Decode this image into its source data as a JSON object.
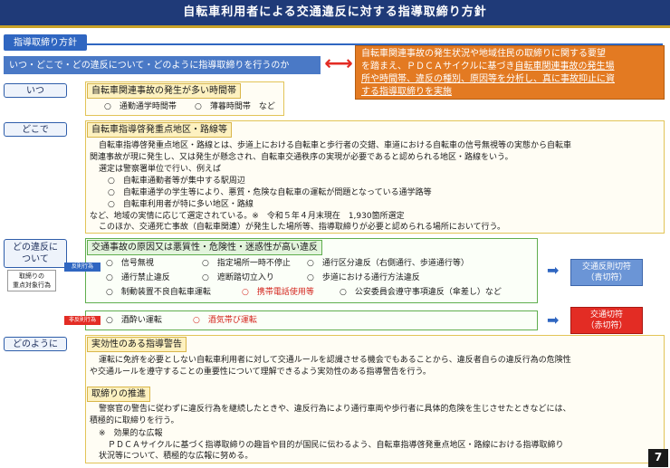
{
  "title": "自転車利用者による交通違反に対する指導取締り方針",
  "policy_tab": "指導取締り方針",
  "question": "いつ・どこで・どの違反について・どのように指導取締りを行うのか",
  "orange_box": {
    "line1": "自転車関連事故の発生状況や地域住民の取締りに関する要望",
    "line2a": "を踏まえ、ＰＤＣＡサイクルに基づき",
    "line2b": "自転車関連事故の発生場",
    "line3": "所や時間帯、違反の種別、原因等を分析し、真に事故抑止に資",
    "line4": "する指導取締りを実施"
  },
  "when": {
    "label": "いつ",
    "header": "自転車関連事故の発生が多い時間帯",
    "item1": "○　通勤通学時間帯",
    "item2": "○　薄暮時間帯　など"
  },
  "where": {
    "label": "どこで",
    "header": "自転車指導啓発重点地区・路線等",
    "p1": "自転車指導啓発重点地区・路線とは、歩道上における自転車と歩行者の交錯、車道における自転車の信号無視等の実態から自転車",
    "p1b": "関連事故が現に発生し、又は発生が懸念され、自転車交通秩序の実現が必要であると認められる地区・路線をいう。",
    "p2": "選定は警察署単位で行い、例えば",
    "b1": "○　自転車通勤者等が集中する駅周辺",
    "b2": "○　自転車通学の学生等により、悪質・危険な自転車の運転が問題となっている通学路等",
    "b3": "○　自転車利用者が特に多い地区・路線",
    "p3": "など、地域の実情に応じて選定されている。※　令和５年４月末現在　1,930箇所選定",
    "p4": "このほか、交通死亡事故（自転車関連）が発生した場所等、指導取締りが必要と認められる場所において行う。"
  },
  "which": {
    "label_line1": "どの違反に",
    "label_line2": "ついて",
    "small_tag_line1": "取締りの",
    "small_tag_line2": "重点対象行為",
    "header": "交通事故の原因又は悪質性・危険性・迷惑性が高い違反",
    "tag_blue": "反則行為",
    "tag_red": "非反則行為",
    "r1": [
      "○　信号無視",
      "○　指定場所一時不停止",
      "○　通行区分違反（右側通行、歩道通行等）"
    ],
    "r2": [
      "○　通行禁止違反",
      "○　遮断踏切立入り",
      "○　歩道における通行方法違反"
    ],
    "r3a": "○　制動装置不良自転車運転",
    "r3b": "○　携帯電話使用等",
    "r3c": "○　公安委員会遵守事項違反（傘差し）など",
    "nr1": "○　酒酔い運転",
    "nr2": "○　酒気帯び運転",
    "ticket_blue_1": "交通反則切符",
    "ticket_blue_2": "（青切符）",
    "ticket_red_1": "交通切符",
    "ticket_red_2": "（赤切符）"
  },
  "how": {
    "label": "どのように",
    "header1": "実効性のある指導警告",
    "t1a": "運転に免許を必要としない自転車利用者に対して交通ルールを認識させる機会でもあることから、違反者自らの違反行為の危険性",
    "t1b": "や交通ルールを遵守することの重要性について理解できるよう実効性のある指導警告を行う。",
    "header2": "取締りの推進",
    "t2a": "警察官の警告に従わずに違反行為を継続したときや、違反行為により通行車両や歩行者に具体的危険を生じさせたときなどには、",
    "t2b": "積極的に取締りを行う。",
    "t3": "※　効果的な広報",
    "t4a": "ＰＤＣＡサイクルに基づく指導取締りの趣旨や目的が国民に伝わるよう、自転車指導啓発重点地区・路線における指導取締り",
    "t4b": "状況等について、積極的な広報に努める。"
  },
  "page_number": "7",
  "colors": {
    "navy": "#1f3a78",
    "blue": "#2f66c1",
    "orange": "#e37a22",
    "red": "#e32c24",
    "green": "#5fae4e",
    "yellow": "#fdf1c0"
  }
}
